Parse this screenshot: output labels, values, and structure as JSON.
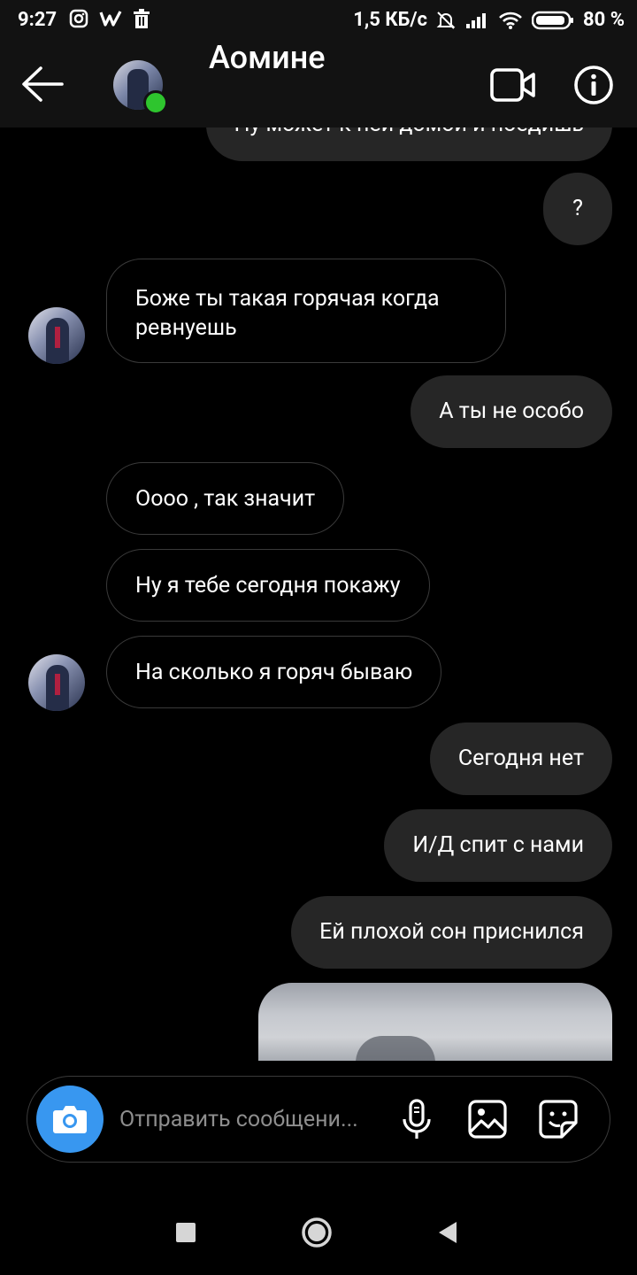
{
  "status": {
    "time": "9:27",
    "speed": "1,5 КБ/с",
    "battery": "80 %"
  },
  "header": {
    "title": "Аомине"
  },
  "messages": [
    {
      "side": "out",
      "text": "Ну может к ней домой и поедишь"
    },
    {
      "side": "out",
      "text": "?"
    },
    {
      "side": "in",
      "text": "Боже ты такая горячая  когда ревнуешь"
    },
    {
      "side": "out",
      "text": "А ты не особо"
    },
    {
      "side": "in",
      "text": "Оооо , так значит"
    },
    {
      "side": "in",
      "text": "Ну я тебе сегодня покажу"
    },
    {
      "side": "in",
      "text": "На сколько я горяч бываю"
    },
    {
      "side": "out",
      "text": "Сегодня нет"
    },
    {
      "side": "out",
      "text": "И/Д спит с нами"
    },
    {
      "side": "out",
      "text": "Ей плохой сон приснился"
    }
  ],
  "composer": {
    "placeholder": "Отправить сообщени..."
  },
  "colors": {
    "accent": "#3897f0",
    "online": "#2ec52e",
    "bubble_out": "#262626"
  }
}
